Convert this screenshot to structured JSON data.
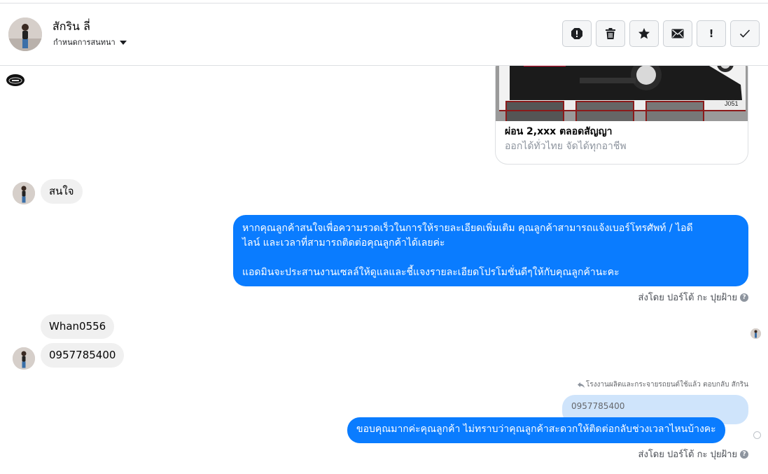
{
  "header": {
    "contact_name": "สักริน ลี่",
    "assign_label": "กำหนดการสนทนา"
  },
  "actions": [
    {
      "name": "report-icon"
    },
    {
      "name": "trash-icon"
    },
    {
      "name": "star-icon"
    },
    {
      "name": "envelope-icon"
    },
    {
      "name": "exclamation-icon",
      "glyph": "!"
    },
    {
      "name": "checkmark-icon"
    }
  ],
  "card": {
    "image_code": "J051",
    "title": "ผ่อน 2,xxx ตลอดสัญญา",
    "subtitle": "ออกได้ทั่วไทย จัดได้ทุกอาชีพ"
  },
  "messages": {
    "m1": "สนใจ",
    "m2_line1": "หากคุณลูกค้าสนใจเพื่อความรวดเร็วในการให้รายละเอียดเพิ่มเติม คุณลูกค้าสามารถแจ้งเบอร์โทรศัพท์ / ไอดี",
    "m2_line2": "ไลน์ และเวลาที่สามารถติดต่อคุณลูกค้าได้เลยค่ะ",
    "m2_line3": "แอดมินจะประสานงานเซลล์ให้ดูแลและชี้แจงรายละเอียดโปรโมชั่นดีๆให้กับคุณลูกค้านะคะ",
    "sent_by_1": "ส่งโดย ปอร์โต้ กะ ปุยฝ้าย",
    "m3": "Whan0556",
    "m4": "0957785400",
    "reply_note": "โรงงานผลิตและกระจายรถยนต์ใช้แล้ว ตอบกลับ สักริน",
    "quoted": "0957785400",
    "m5": "ขอบคุณมากค่ะคุณลูกค้า ไม่ทราบว่าคุณลูกค้าสะดวกให้ติดต่อกลับช่วงเวลาไหนบ้างคะ",
    "sent_by_2": "ส่งโดย ปอร์โต้ กะ ปุยฝ้าย"
  },
  "colors": {
    "outgoing_bubble": "#0a7cff",
    "incoming_bubble": "#f0f0f0",
    "quoted_bubble": "#cfe4fb"
  }
}
